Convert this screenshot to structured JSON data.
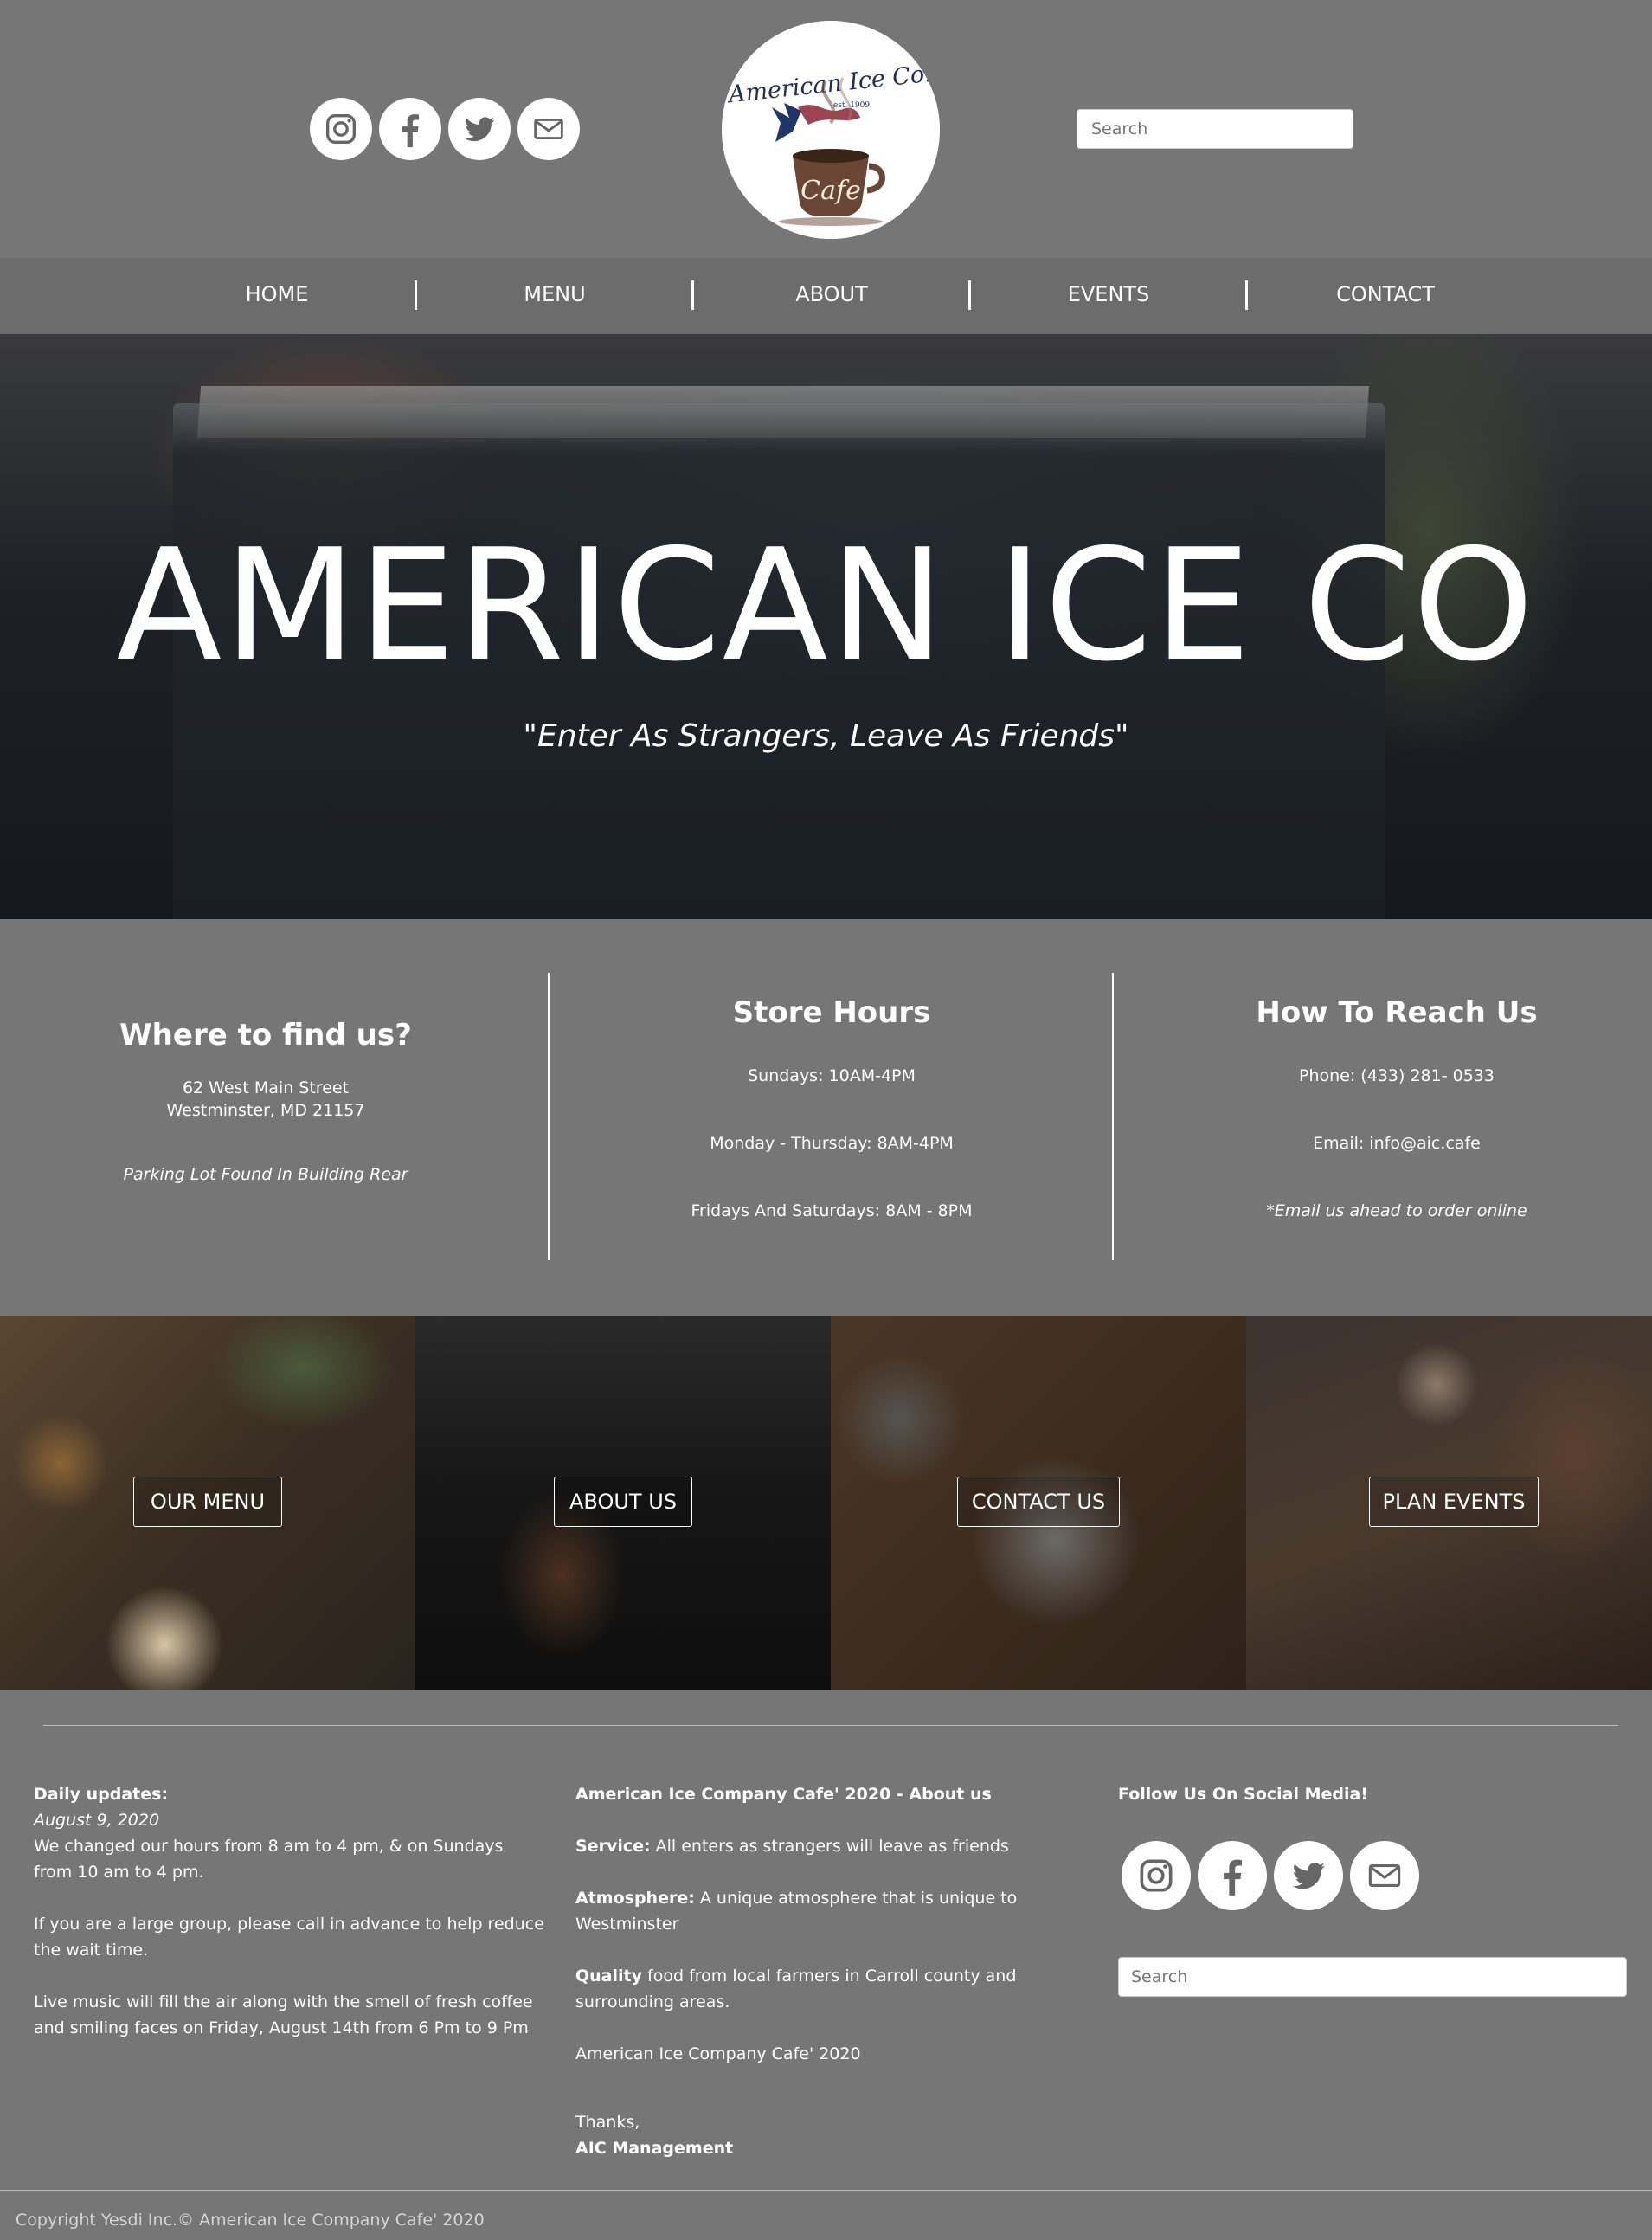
{
  "header": {
    "social": [
      {
        "icon": "instagram-icon"
      },
      {
        "icon": "facebook-icon"
      },
      {
        "icon": "twitter-icon"
      },
      {
        "icon": "email-icon"
      }
    ],
    "logo": {
      "line1": "American Ice Co.",
      "est": "est. 1909",
      "cup": "Cafe"
    },
    "search_placeholder": "Search"
  },
  "nav": {
    "items": [
      "HOME",
      "MENU",
      "ABOUT",
      "EVENTS",
      "CONTACT"
    ]
  },
  "hero": {
    "title": "AMERICAN ICE CO",
    "tagline": "\"Enter As Strangers, Leave As Friends\""
  },
  "info": {
    "find": {
      "heading": "Where to find us?",
      "street": "62 West Main Street",
      "city": "Westminster, MD 21157",
      "parking": "Parking Lot Found In Building Rear"
    },
    "hours": {
      "heading": "Store Hours",
      "sun": "Sundays: 10AM-4PM",
      "mon_thu": "Monday - Thursday: 8AM-4PM",
      "fri_sat": "Fridays And Saturdays: 8AM - 8PM"
    },
    "reach": {
      "heading": "How To Reach Us",
      "phone": "Phone: (433) 281- 0533",
      "email": "Email: info@aic.cafe",
      "note": "*Email us ahead to order online"
    }
  },
  "tiles": [
    "OUR MENU",
    "ABOUT US",
    "CONTACT US",
    "PLAN EVENTS"
  ],
  "footer": {
    "updates": {
      "title": "Daily updates:",
      "date": "August 9, 2020",
      "p1": "We changed our hours from 8 am to 4 pm, & on Sundays from 10 am to 4 pm.",
      "p2": "If you are a large group, please call in advance to help reduce the wait time.",
      "p3": "Live music will fill the air along with the smell of fresh coffee and smiling faces on Friday, August 14th from 6 Pm to 9 Pm"
    },
    "about": {
      "title": "American Ice Company Cafe' 2020 - About us",
      "service_label": "Service:",
      "service_text": " All enters as strangers will leave as friends",
      "atmo_label": "Atmosphere:",
      "atmo_text": " A unique atmosphere that is unique to Westminster",
      "quality_label": "Quality",
      "quality_text": " food from local farmers in Carroll county and surrounding areas.",
      "line": "American Ice Company Cafe' 2020",
      "thanks": "Thanks,",
      "signoff": "AIC Management"
    },
    "follow": {
      "title": "Follow Us On Social Media!",
      "search_placeholder": "Search"
    },
    "copyright": "Copyright Yesdi Inc.© American Ice Company Cafe' 2020"
  },
  "colors": {
    "page_bg": "#767676",
    "nav_bg": "#6c6c6c",
    "text": "#ffffff"
  }
}
